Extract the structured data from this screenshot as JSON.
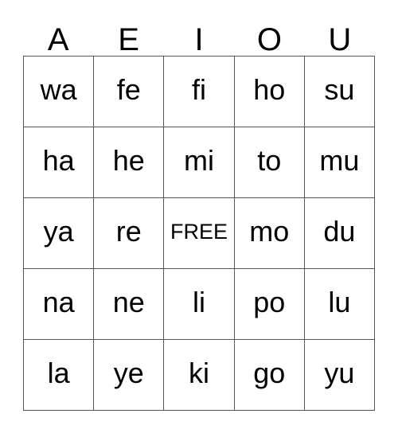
{
  "card": {
    "headers": [
      "A",
      "E",
      "I",
      "O",
      "U"
    ],
    "rows": [
      [
        "wa",
        "fe",
        "fi",
        "ho",
        "su"
      ],
      [
        "ha",
        "he",
        "mi",
        "to",
        "mu"
      ],
      [
        "ya",
        "re",
        "FREE",
        "mo",
        "du"
      ],
      [
        "na",
        "ne",
        "li",
        "po",
        "lu"
      ],
      [
        "la",
        "ye",
        "ki",
        "go",
        "yu"
      ]
    ],
    "free_space": {
      "label": "FREE",
      "row": 2,
      "column": 2
    },
    "colors": {
      "background": "#ffffff",
      "text": "#000000",
      "border": "#555555"
    }
  }
}
